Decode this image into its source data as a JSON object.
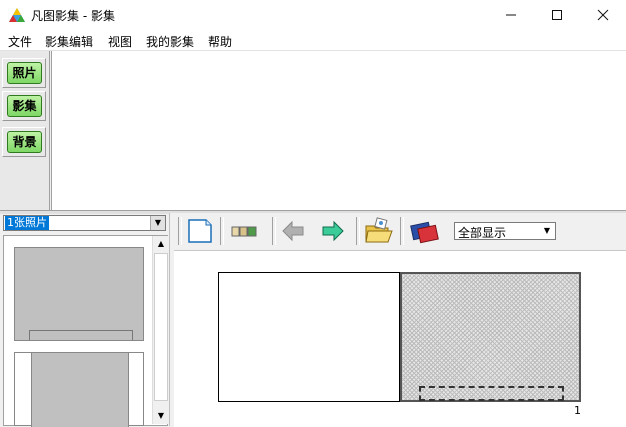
{
  "window": {
    "title": "凡图影集 - 影集"
  },
  "menu": {
    "items": [
      "文件",
      "影集编辑",
      "视图",
      "我的影集",
      "帮助"
    ]
  },
  "sidebar": {
    "buttons": [
      "照片",
      "影集",
      "背景"
    ]
  },
  "photo_select": {
    "value": "1张照片"
  },
  "toolbar": {
    "icons": [
      "new-page-icon",
      "layout-icon",
      "prev-arrow-icon",
      "next-arrow-icon",
      "open-folder-icon",
      "album-icon"
    ],
    "display_mode": "全部显示"
  },
  "canvas": {
    "page_number": "1"
  },
  "colors": {
    "button_green": "#7ed765",
    "selection_blue": "#0078d7"
  }
}
